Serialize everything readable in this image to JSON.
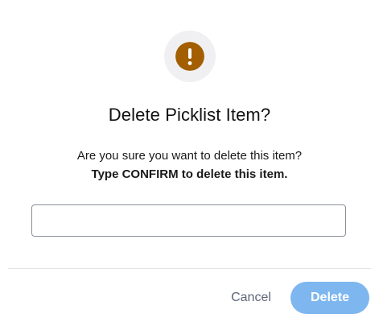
{
  "dialog": {
    "icon": "exclamation-circle-icon",
    "title": "Delete Picklist Item?",
    "message": "Are you sure you want to delete this item?",
    "instruction": "Type CONFIRM to delete this item.",
    "input": {
      "value": "",
      "placeholder": ""
    },
    "cancel_label": "Cancel",
    "delete_label": "Delete"
  },
  "colors": {
    "warning_icon": "#a35e00",
    "icon_background": "#f0f0f2",
    "delete_button": "#7eb6ef",
    "cancel_text": "#5d6478"
  }
}
